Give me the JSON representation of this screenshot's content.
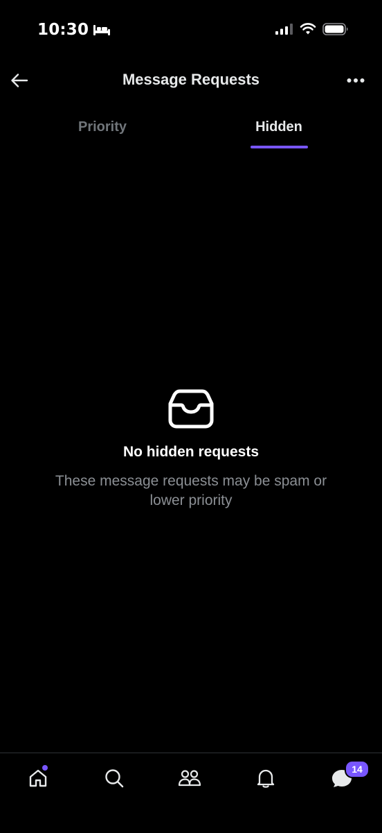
{
  "status_bar": {
    "time": "10:30",
    "icons": [
      "sleep-icon",
      "cellular-signal-icon",
      "wifi-icon",
      "battery-icon"
    ]
  },
  "header": {
    "title": "Message Requests",
    "back_icon": "arrow-left-icon",
    "more_icon": "more-horizontal-icon"
  },
  "tabs": [
    {
      "label": "Priority",
      "selected": false
    },
    {
      "label": "Hidden",
      "selected": true
    }
  ],
  "empty_state": {
    "icon": "inbox-icon",
    "title": "No hidden requests",
    "subtitle": "These message requests may be spam or lower priority"
  },
  "bottom_nav": {
    "items": [
      {
        "icon": "home-icon",
        "has_dot": true
      },
      {
        "icon": "search-icon"
      },
      {
        "icon": "communities-icon"
      },
      {
        "icon": "notifications-bell-icon"
      },
      {
        "icon": "messages-icon",
        "badge": "14"
      }
    ]
  },
  "colors": {
    "background": "#000000",
    "accent": "#7856ff",
    "text_primary": "#e7e9ea",
    "text_secondary": "#71767b",
    "divider": "#2f3336"
  }
}
